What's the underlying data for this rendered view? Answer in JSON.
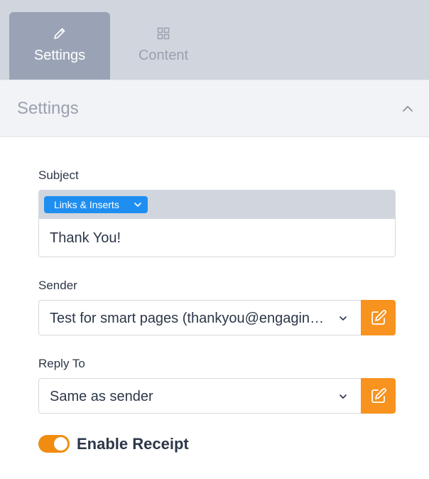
{
  "tabs": {
    "settings": {
      "label": "Settings",
      "icon": "pencil-icon",
      "active": true
    },
    "content": {
      "label": "Content",
      "icon": "grid-icon",
      "active": false
    }
  },
  "section": {
    "title": "Settings",
    "collapse_icon": "chevron-up-icon"
  },
  "subject": {
    "label": "Subject",
    "links_button": "Links & Inserts",
    "value": "Thank You!"
  },
  "sender": {
    "label": "Sender",
    "value": "Test for smart pages (thankyou@engagingnetworks.net)",
    "edit_icon": "edit-icon"
  },
  "reply_to": {
    "label": "Reply To",
    "value": "Same as sender",
    "edit_icon": "edit-icon"
  },
  "receipt": {
    "label": "Enable Receipt",
    "enabled": true
  },
  "colors": {
    "accent": "#f7931e",
    "link_button": "#1f8ef1",
    "tab_active": "#9aa3b6",
    "tab_bar": "#d1d5de"
  }
}
